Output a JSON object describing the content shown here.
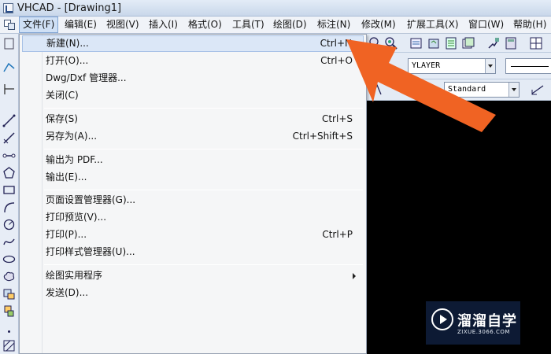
{
  "window": {
    "title": "VHCAD - [Drawing1]"
  },
  "menubar": {
    "items": [
      {
        "label": "文件(F)",
        "active": true
      },
      {
        "label": "编辑(E)"
      },
      {
        "label": "视图(V)"
      },
      {
        "label": "插入(I)"
      },
      {
        "label": "格式(O)"
      },
      {
        "label": "工具(T)"
      },
      {
        "label": "绘图(D)"
      },
      {
        "label": "标注(N)"
      },
      {
        "label": "修改(M)"
      },
      {
        "label": "扩展工具(X)"
      },
      {
        "label": "窗口(W)"
      },
      {
        "label": "帮助(H)"
      }
    ]
  },
  "file_menu": {
    "items": [
      {
        "label": "新建(N)...",
        "shortcut": "Ctrl+N",
        "highlighted": true
      },
      {
        "label": "打开(O)...",
        "shortcut": "Ctrl+O"
      },
      {
        "label": "Dwg/Dxf 管理器...",
        "shortcut": ""
      },
      {
        "label": "关闭(C)",
        "shortcut": ""
      },
      {
        "label": "保存(S)",
        "shortcut": "Ctrl+S"
      },
      {
        "label": "另存为(A)...",
        "shortcut": "Ctrl+Shift+S"
      },
      {
        "label": "输出为 PDF...",
        "shortcut": ""
      },
      {
        "label": "输出(E)...",
        "shortcut": ""
      },
      {
        "label": "页面设置管理器(G)...",
        "shortcut": ""
      },
      {
        "label": "打印预览(V)...",
        "shortcut": ""
      },
      {
        "label": "打印(P)...",
        "shortcut": "Ctrl+P"
      },
      {
        "label": "打印样式管理器(U)...",
        "shortcut": ""
      },
      {
        "label": "绘图实用程序",
        "shortcut": "",
        "submenu": true
      },
      {
        "label": "发送(D)...",
        "shortcut": ""
      }
    ]
  },
  "toolbar": {
    "layer_combo": "YLAYER",
    "linetype_combo": "",
    "textstyle_combo": "Standard"
  },
  "watermark": {
    "name": "溜溜自学",
    "url": "ZIXUE.3066.COM"
  },
  "colors": {
    "annotation_arrow": "#f06323",
    "canvas": "#000000",
    "menu_highlight": "#dbe7f7"
  }
}
